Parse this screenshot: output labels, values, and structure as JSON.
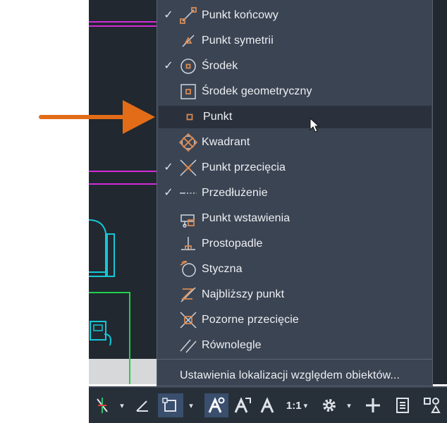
{
  "menu": {
    "items": [
      {
        "label": "Punkt końcowy",
        "checked": true,
        "icon": "endpoint-icon"
      },
      {
        "label": "Punkt symetrii",
        "checked": false,
        "icon": "midpoint-icon"
      },
      {
        "label": "Środek",
        "checked": true,
        "icon": "center-icon"
      },
      {
        "label": "Środek geometryczny",
        "checked": false,
        "icon": "geometric-center-icon"
      },
      {
        "label": "Punkt",
        "checked": false,
        "icon": "node-icon",
        "highlighted": true
      },
      {
        "label": "Kwadrant",
        "checked": false,
        "icon": "quadrant-icon"
      },
      {
        "label": "Punkt przecięcia",
        "checked": true,
        "icon": "intersection-icon"
      },
      {
        "label": "Przedłużenie",
        "checked": true,
        "icon": "extension-icon"
      },
      {
        "label": "Punkt wstawienia",
        "checked": false,
        "icon": "insertion-icon"
      },
      {
        "label": "Prostopadle",
        "checked": false,
        "icon": "perpendicular-icon"
      },
      {
        "label": "Styczna",
        "checked": false,
        "icon": "tangent-icon"
      },
      {
        "label": "Najbliższy punkt",
        "checked": false,
        "icon": "nearest-icon"
      },
      {
        "label": "Pozorne przecięcie",
        "checked": false,
        "icon": "apparent-intersection-icon"
      },
      {
        "label": "Równolegle",
        "checked": false,
        "icon": "parallel-icon"
      }
    ],
    "settings_label": "Ustawienia lokalizacji względem obiektów...",
    "check_glyph": "✓"
  },
  "status_bar": {
    "scale_label": "1:1",
    "caret": "▾"
  },
  "colors": {
    "menu_bg": "#3b4453",
    "highlight_bg": "#2a313c",
    "icon_orange": "#d98a53",
    "arrow_orange": "#e36c18",
    "status_active": "#3a4e6e"
  }
}
